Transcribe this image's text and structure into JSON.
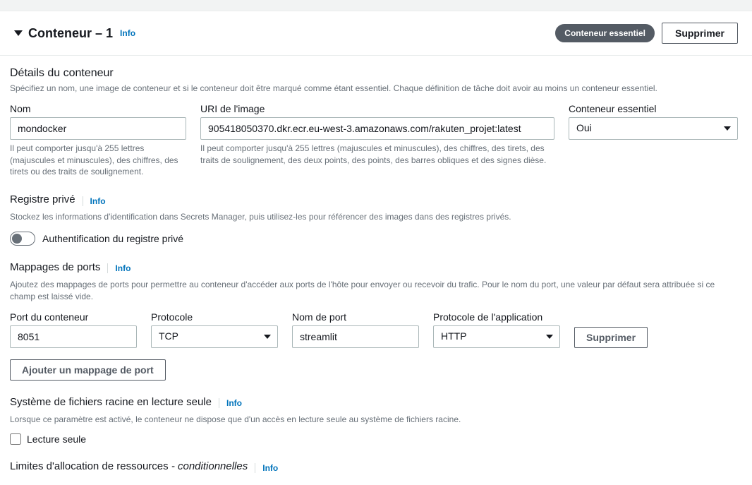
{
  "header": {
    "title": "Conteneur – 1",
    "info": "Info",
    "badge": "Conteneur essentiel",
    "delete": "Supprimer"
  },
  "details": {
    "title": "Détails du conteneur",
    "desc": "Spécifiez un nom, une image de conteneur et si le conteneur doit être marqué comme étant essentiel. Chaque définition de tâche doit avoir au moins un conteneur essentiel.",
    "name_label": "Nom",
    "name_value": "mondocker",
    "name_hint": "Il peut comporter jusqu'à 255 lettres (majuscules et minuscules), des chiffres, des tirets ou des traits de soulignement.",
    "uri_label": "URI de l'image",
    "uri_value": "905418050370.dkr.ecr.eu-west-3.amazonaws.com/rakuten_projet:latest",
    "uri_hint": "Il peut comporter jusqu'à 255 lettres (majuscules et minuscules), des chiffres, des tirets, des traits de soulignement, des deux points, des points, des barres obliques et des signes dièse.",
    "essential_label": "Conteneur essentiel",
    "essential_value": "Oui"
  },
  "private_registry": {
    "title": "Registre privé",
    "info": "Info",
    "desc": "Stockez les informations d'identification dans Secrets Manager, puis utilisez-les pour référencer des images dans des registres privés.",
    "toggle_label": "Authentification du registre privé"
  },
  "port_mappings": {
    "title": "Mappages de ports",
    "info": "Info",
    "desc": "Ajoutez des mappages de ports pour permettre au conteneur d'accéder aux ports de l'hôte pour envoyer ou recevoir du trafic. Pour le nom du port, une valeur par défaut sera attribuée si ce champ est laissé vide.",
    "port_label": "Port du conteneur",
    "protocol_label": "Protocole",
    "portname_label": "Nom de port",
    "appproto_label": "Protocole de l'application",
    "remove": "Supprimer",
    "add_button": "Ajouter un mappage de port",
    "rows": [
      {
        "port": "8051",
        "protocol": "TCP",
        "port_name": "streamlit",
        "app_protocol": "HTTP"
      }
    ]
  },
  "readonly_fs": {
    "title": "Système de fichiers racine en lecture seule",
    "info": "Info",
    "desc": "Lorsque ce paramètre est activé, le conteneur ne dispose que d'un accès en lecture seule au système de fichiers racine.",
    "checkbox_label": "Lecture seule"
  },
  "resource_limits": {
    "title": "Limites d'allocation de ressources",
    "suffix": " - conditionnelles",
    "info": "Info"
  }
}
